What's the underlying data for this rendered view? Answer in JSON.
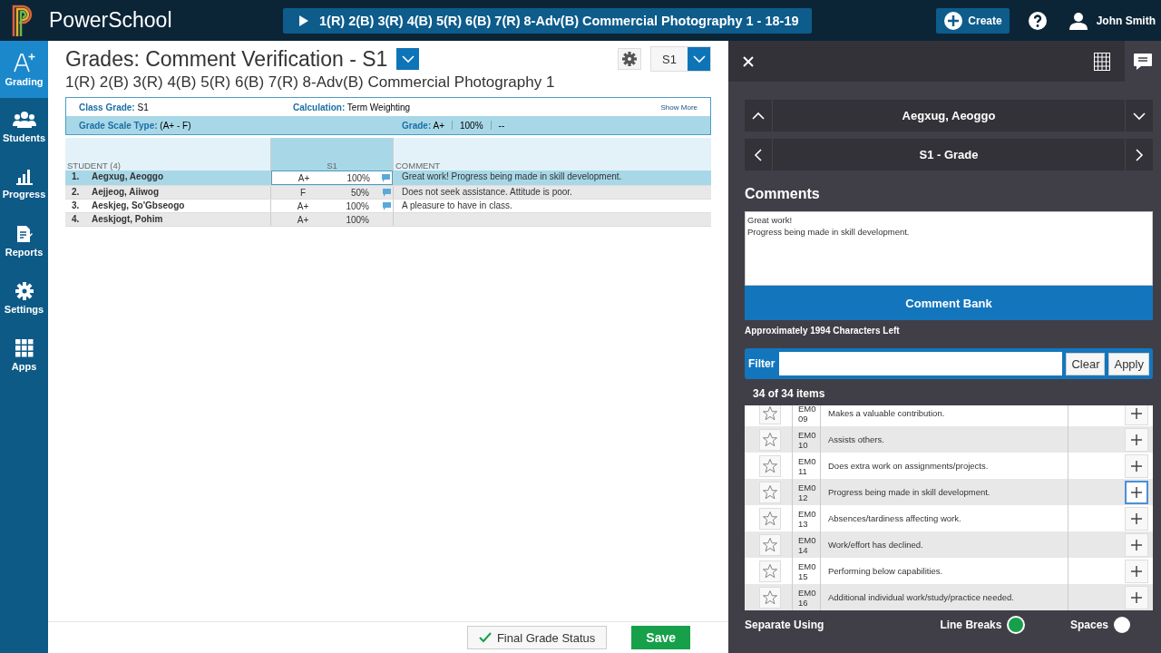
{
  "topbar": {
    "brand": "PowerSchool",
    "section": "1(R) 2(B) 3(R) 4(B) 5(R) 6(B) 7(R) 8-Adv(B) Commercial Photography 1  -  18-19",
    "create": "Create",
    "user": "John Smith"
  },
  "sidebar": {
    "items": [
      {
        "label": "Grading",
        "selected": true
      },
      {
        "label": "Students",
        "selected": false
      },
      {
        "label": "Progress",
        "selected": false
      },
      {
        "label": "Reports",
        "selected": false
      },
      {
        "label": "Settings",
        "selected": false
      },
      {
        "label": "Apps",
        "selected": false
      }
    ]
  },
  "main": {
    "title": "Grades: Comment Verification - S1",
    "subtitle": "1(R) 2(B) 3(R) 4(B) 5(R) 6(B) 7(R) 8-Adv(B) Commercial Photography 1",
    "term": "S1",
    "info": {
      "class_grade_label": "Class Grade:",
      "class_grade": "S1",
      "calculation_label": "Calculation:",
      "calculation": "Term Weighting",
      "show_more": "Show More",
      "scale_label": "Grade Scale Type:",
      "scale": "(A+ - F)",
      "grade_label": "Grade:",
      "grade": "A+",
      "percent": "100%",
      "extra": "--"
    },
    "table": {
      "columns": [
        "STUDENT (4)",
        "S1",
        "COMMENT"
      ],
      "rows": [
        {
          "number": "1.",
          "name": "Aegxug, Aeoggo",
          "grade": "A+",
          "percent": "100%",
          "comment": "Great work! Progress being made in skill development.",
          "selected": true
        },
        {
          "number": "2.",
          "name": "Aejjeog, Aiiwog",
          "grade": "F",
          "percent": "50%",
          "comment": "Does not seek assistance. Attitude is poor.",
          "selected": false
        },
        {
          "number": "3.",
          "name": "Aeskjeg, So'Gbseogo",
          "grade": "A+",
          "percent": "100%",
          "comment": "A pleasure to have in class.",
          "selected": false
        },
        {
          "number": "4.",
          "name": "Aeskjogt, Pohim",
          "grade": "A+",
          "percent": "100%",
          "selected": false
        }
      ]
    },
    "footer": {
      "final": "Final Grade Status",
      "save": "Save"
    }
  },
  "panel": {
    "student": "Aegxug, Aeoggo",
    "grade_nav": "S1 - Grade",
    "comments_heading": "Comments",
    "comment_lines": [
      "Great work!",
      "Progress being made in skill development."
    ],
    "comment_bank": "Comment Bank",
    "chars_left": "Approximately 1994 Characters Left",
    "filter_label": "Filter",
    "clear": "Clear",
    "apply": "Apply",
    "count": "34 of 34 items",
    "bank": [
      {
        "code": "EM009",
        "text": "Makes a valuable contribution.",
        "focused": false
      },
      {
        "code": "EM010",
        "text": "Assists others.",
        "focused": false
      },
      {
        "code": "EM011",
        "text": "Does extra work on assignments/projects.",
        "focused": false
      },
      {
        "code": "EM012",
        "text": "Progress being made in skill development.",
        "focused": true
      },
      {
        "code": "EM013",
        "text": "Absences/tardiness affecting work.",
        "focused": false
      },
      {
        "code": "EM014",
        "text": "Work/effort has declined.",
        "focused": false
      },
      {
        "code": "EM015",
        "text": "Performing below capabilities.",
        "focused": false
      },
      {
        "code": "EM016",
        "text": "Additional individual work/study/practice needed.",
        "focused": false
      }
    ],
    "separate_label": "Separate Using",
    "options": [
      {
        "label": "Line Breaks",
        "selected": true
      },
      {
        "label": "Spaces",
        "selected": false
      }
    ]
  }
}
